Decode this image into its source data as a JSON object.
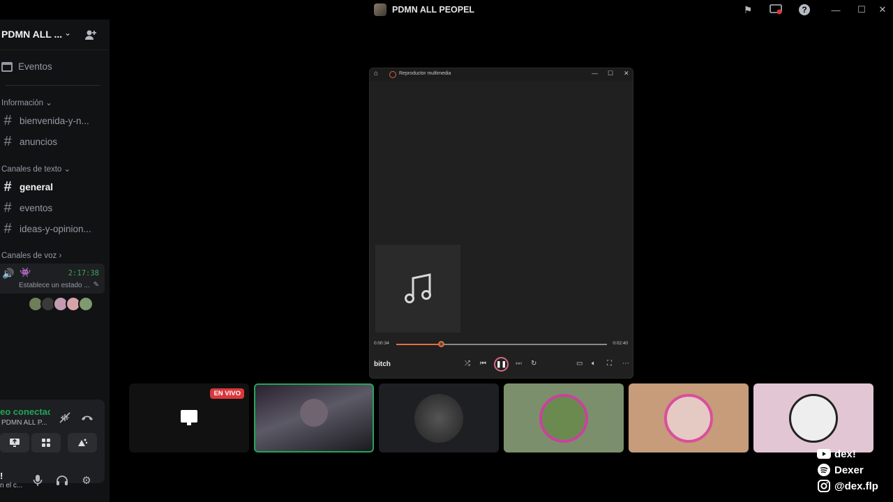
{
  "window": {
    "title": "PDMN ALL PEOPEL"
  },
  "sidebar": {
    "server_name": "PDMN ALL ...",
    "events_label": "Eventos",
    "categories": {
      "info": "Información",
      "text": "Canales de texto",
      "voice": "Canales de voz"
    },
    "channels": [
      {
        "name": "bienvenida-y-n...",
        "active": false
      },
      {
        "name": "anuncios",
        "active": false
      },
      {
        "name": "general",
        "active": true
      },
      {
        "name": "eventos",
        "active": false
      },
      {
        "name": "ideas-y-opinion...",
        "active": false
      }
    ],
    "voice_channel": {
      "timer": "2:17:38",
      "status": "Establece un estado ..."
    }
  },
  "voice_panel": {
    "status": "eo conectac",
    "server": "PDMN ALL P...",
    "user_name": "!",
    "user_sub": "n el c..."
  },
  "player": {
    "title": "Reproductor multimedia",
    "current_time": "0:00:34",
    "duration": "0:02:40",
    "progress": 0.2125,
    "song": "bitch"
  },
  "tiles": {
    "live_badge": "EN VIVO"
  },
  "social": {
    "youtube": "dex!",
    "spotify": "Dexer",
    "instagram": "@dex.flp"
  }
}
